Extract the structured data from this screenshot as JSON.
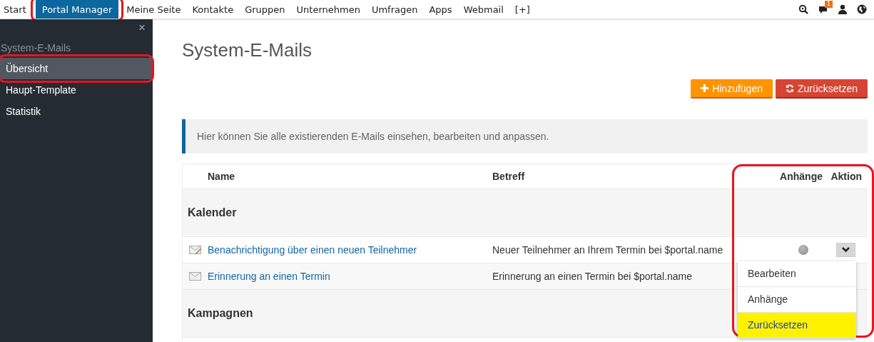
{
  "top_nav": {
    "items": [
      {
        "label": "Start",
        "selected": false,
        "highlighted": false
      },
      {
        "label": "Portal Manager",
        "selected": true,
        "highlighted": true
      },
      {
        "label": "Meine Seite",
        "selected": false,
        "highlighted": false
      },
      {
        "label": "Kontakte",
        "selected": false,
        "highlighted": false
      },
      {
        "label": "Gruppen",
        "selected": false,
        "highlighted": false
      },
      {
        "label": "Unternehmen",
        "selected": false,
        "highlighted": false
      },
      {
        "label": "Umfragen",
        "selected": false,
        "highlighted": false
      },
      {
        "label": "Apps",
        "selected": false,
        "highlighted": false
      },
      {
        "label": "Webmail",
        "selected": false,
        "highlighted": false
      },
      {
        "label": "[+]",
        "selected": false,
        "highlighted": false
      }
    ],
    "message_badge": "1"
  },
  "sidebar": {
    "close": "×",
    "heading": "System-E-Mails",
    "items": [
      {
        "label": "Übersicht",
        "selected": true,
        "highlighted": true
      },
      {
        "label": "Haupt-Template",
        "selected": false,
        "highlighted": false
      },
      {
        "label": "Statistik",
        "selected": false,
        "highlighted": false
      }
    ]
  },
  "page_title": "System-E-Mails",
  "buttons": [
    {
      "label": "Hinzufügen",
      "kind": "add"
    },
    {
      "label": "Zurücksetzen",
      "kind": "reset"
    }
  ],
  "info": "Hier können Sie alle existierenden E-Mails einsehen, bearbeiten und anpassen.",
  "table": {
    "columns": [
      "Name",
      "Betreff",
      "Anhänge",
      "Aktion"
    ],
    "actions_highlighted": true,
    "rows": [
      {
        "kind": "group",
        "label": "Kalender"
      },
      {
        "kind": "mail",
        "edited": true,
        "name": "Benachrichtigung über einen neuen Teilnehmer",
        "subject": "Neuer Teilnehmer an Ihrem Termin bei $portal.name",
        "attachment_dot": true,
        "action_button": true,
        "menu": [
          {
            "label": "Bearbeiten",
            "highlighted": false
          },
          {
            "label": "Anhänge",
            "highlighted": false
          },
          {
            "label": "Zurücksetzen",
            "highlighted": true
          }
        ]
      },
      {
        "kind": "mail",
        "edited": false,
        "name": "Erinnerung an einen Termin",
        "subject": "Erinnerung an einen Termin bei $portal.name"
      },
      {
        "kind": "group",
        "label": "Kampagnen"
      },
      {
        "kind": "blank"
      }
    ]
  }
}
